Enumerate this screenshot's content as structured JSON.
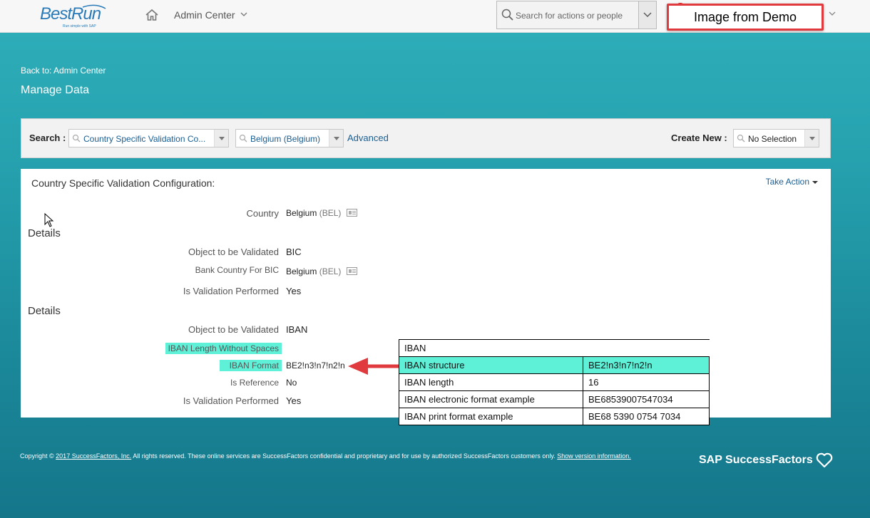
{
  "header": {
    "logo_text": "BestRun",
    "logo_tagline": "Run simple with SAP",
    "nav_title": "Admin Center",
    "search_placeholder": "Search for actions or people",
    "demo_label": "Image from Demo"
  },
  "breadcrumb": {
    "back_label": "Back to: Admin Center"
  },
  "page_title": "Manage Data",
  "search_panel": {
    "search_label": "Search :",
    "object_type_value": "Country Specific Validation Co...",
    "object_value": "Belgium (Belgium)",
    "advanced_label": "Advanced",
    "create_new_label": "Create New :",
    "create_new_value": "No Selection"
  },
  "card": {
    "title": "Country Specific Validation Configuration:",
    "take_action_label": "Take Action",
    "country_label": "Country",
    "country_value": "Belgium",
    "country_code": "(BEL)",
    "section1": {
      "heading": "Details",
      "object_label": "Object to be Validated",
      "object_value": "BIC",
      "bank_country_label": "Bank Country For BIC",
      "bank_country_value": "Belgium",
      "bank_country_code": "(BEL)",
      "validation_label": "Is Validation Performed",
      "validation_value": "Yes"
    },
    "section2": {
      "heading": "Details",
      "object_label": "Object to be Validated",
      "object_value": "IBAN",
      "length_label": "IBAN Length Without Spaces",
      "format_label": "IBAN Format",
      "format_value": "BE2!n3!n7!n2!n",
      "reference_label": "Is Reference",
      "reference_value": "No",
      "validation_label": "Is Validation Performed",
      "validation_value": "Yes"
    }
  },
  "iban_table": {
    "header": "IBAN",
    "rows": [
      {
        "label": "IBAN structure",
        "value": "BE2!n3!n7!n2!n"
      },
      {
        "label": "IBAN length",
        "value": "16"
      },
      {
        "label": "IBAN electronic format example",
        "value": "BE68539007547034"
      },
      {
        "label": "IBAN print format example",
        "value": "BE68 5390 0754 7034"
      }
    ]
  },
  "footer": {
    "copyright_prefix": "Copyright ©",
    "company_link": "2017 SuccessFactors, Inc.",
    "copyright_body": "All rights reserved. These online services are SuccessFactors confidential and proprietary and for use by authorized SuccessFactors customers only.",
    "version_link": "Show version information.",
    "brand": "SAP SuccessFactors"
  },
  "colors": {
    "highlight": "#5ff0d8",
    "link": "#1a5e92",
    "annotation_red": "#e0393e"
  }
}
